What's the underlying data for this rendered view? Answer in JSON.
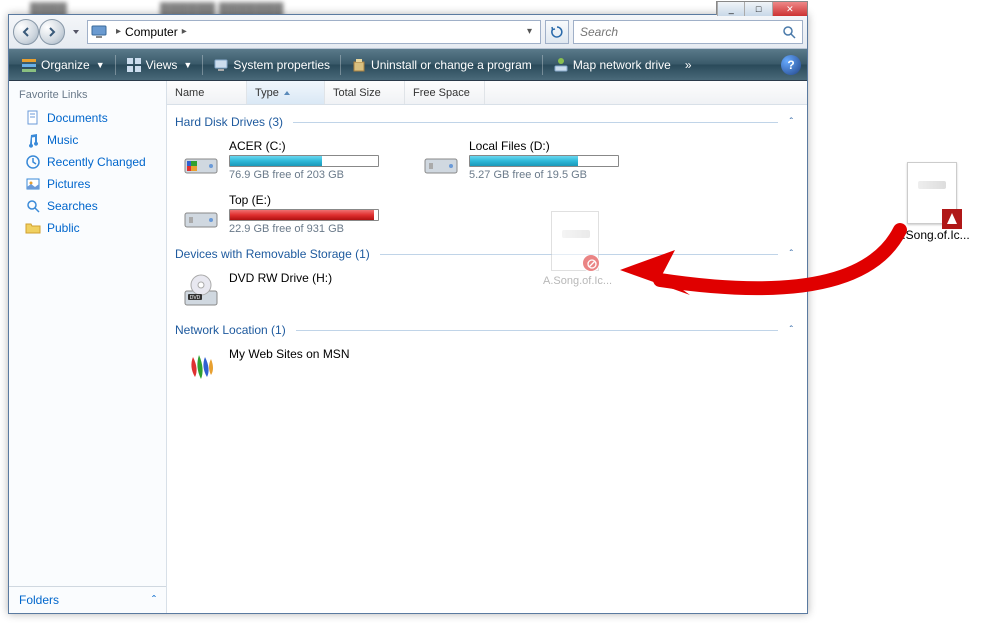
{
  "titlebar": {
    "min": "_",
    "max": "□",
    "close": "✕"
  },
  "address": {
    "location": "Computer",
    "sep": "▸"
  },
  "search": {
    "placeholder": "Search"
  },
  "toolbar": {
    "organize": "Organize",
    "views": "Views",
    "sysprops": "System properties",
    "uninstall": "Uninstall or change a program",
    "mapdrive": "Map network drive",
    "more": "»"
  },
  "sidebar": {
    "header": "Favorite Links",
    "items": [
      {
        "label": "Documents"
      },
      {
        "label": "Music"
      },
      {
        "label": "Recently Changed"
      },
      {
        "label": "Pictures"
      },
      {
        "label": "Searches"
      },
      {
        "label": "Public"
      }
    ],
    "folders": "Folders"
  },
  "columns": {
    "name": "Name",
    "type": "Type",
    "totalsize": "Total Size",
    "freespace": "Free Space"
  },
  "groups": {
    "hdd": {
      "label": "Hard Disk Drives (3)"
    },
    "removable": {
      "label": "Devices with Removable Storage (1)"
    },
    "network": {
      "label": "Network Location (1)"
    }
  },
  "drives": {
    "c": {
      "name": "ACER (C:)",
      "free": "76.9 GB free of 203 GB",
      "fillColor": "#2eb8d8",
      "fillPct": 62
    },
    "d": {
      "name": "Local Files (D:)",
      "free": "5.27 GB free of 19.5 GB",
      "fillColor": "#2eb8d8",
      "fillPct": 73
    },
    "e": {
      "name": "Top (E:)",
      "free": "22.9 GB free of 931 GB",
      "fillColor": "#e03030",
      "fillPct": 97
    },
    "h": {
      "name": "DVD RW Drive (H:)"
    },
    "msn": {
      "name": "My Web Sites on MSN"
    }
  },
  "ghost": {
    "label": "A.Song.of.Ic..."
  },
  "desktopFile": {
    "label": "A.Song.of.Ic..."
  }
}
